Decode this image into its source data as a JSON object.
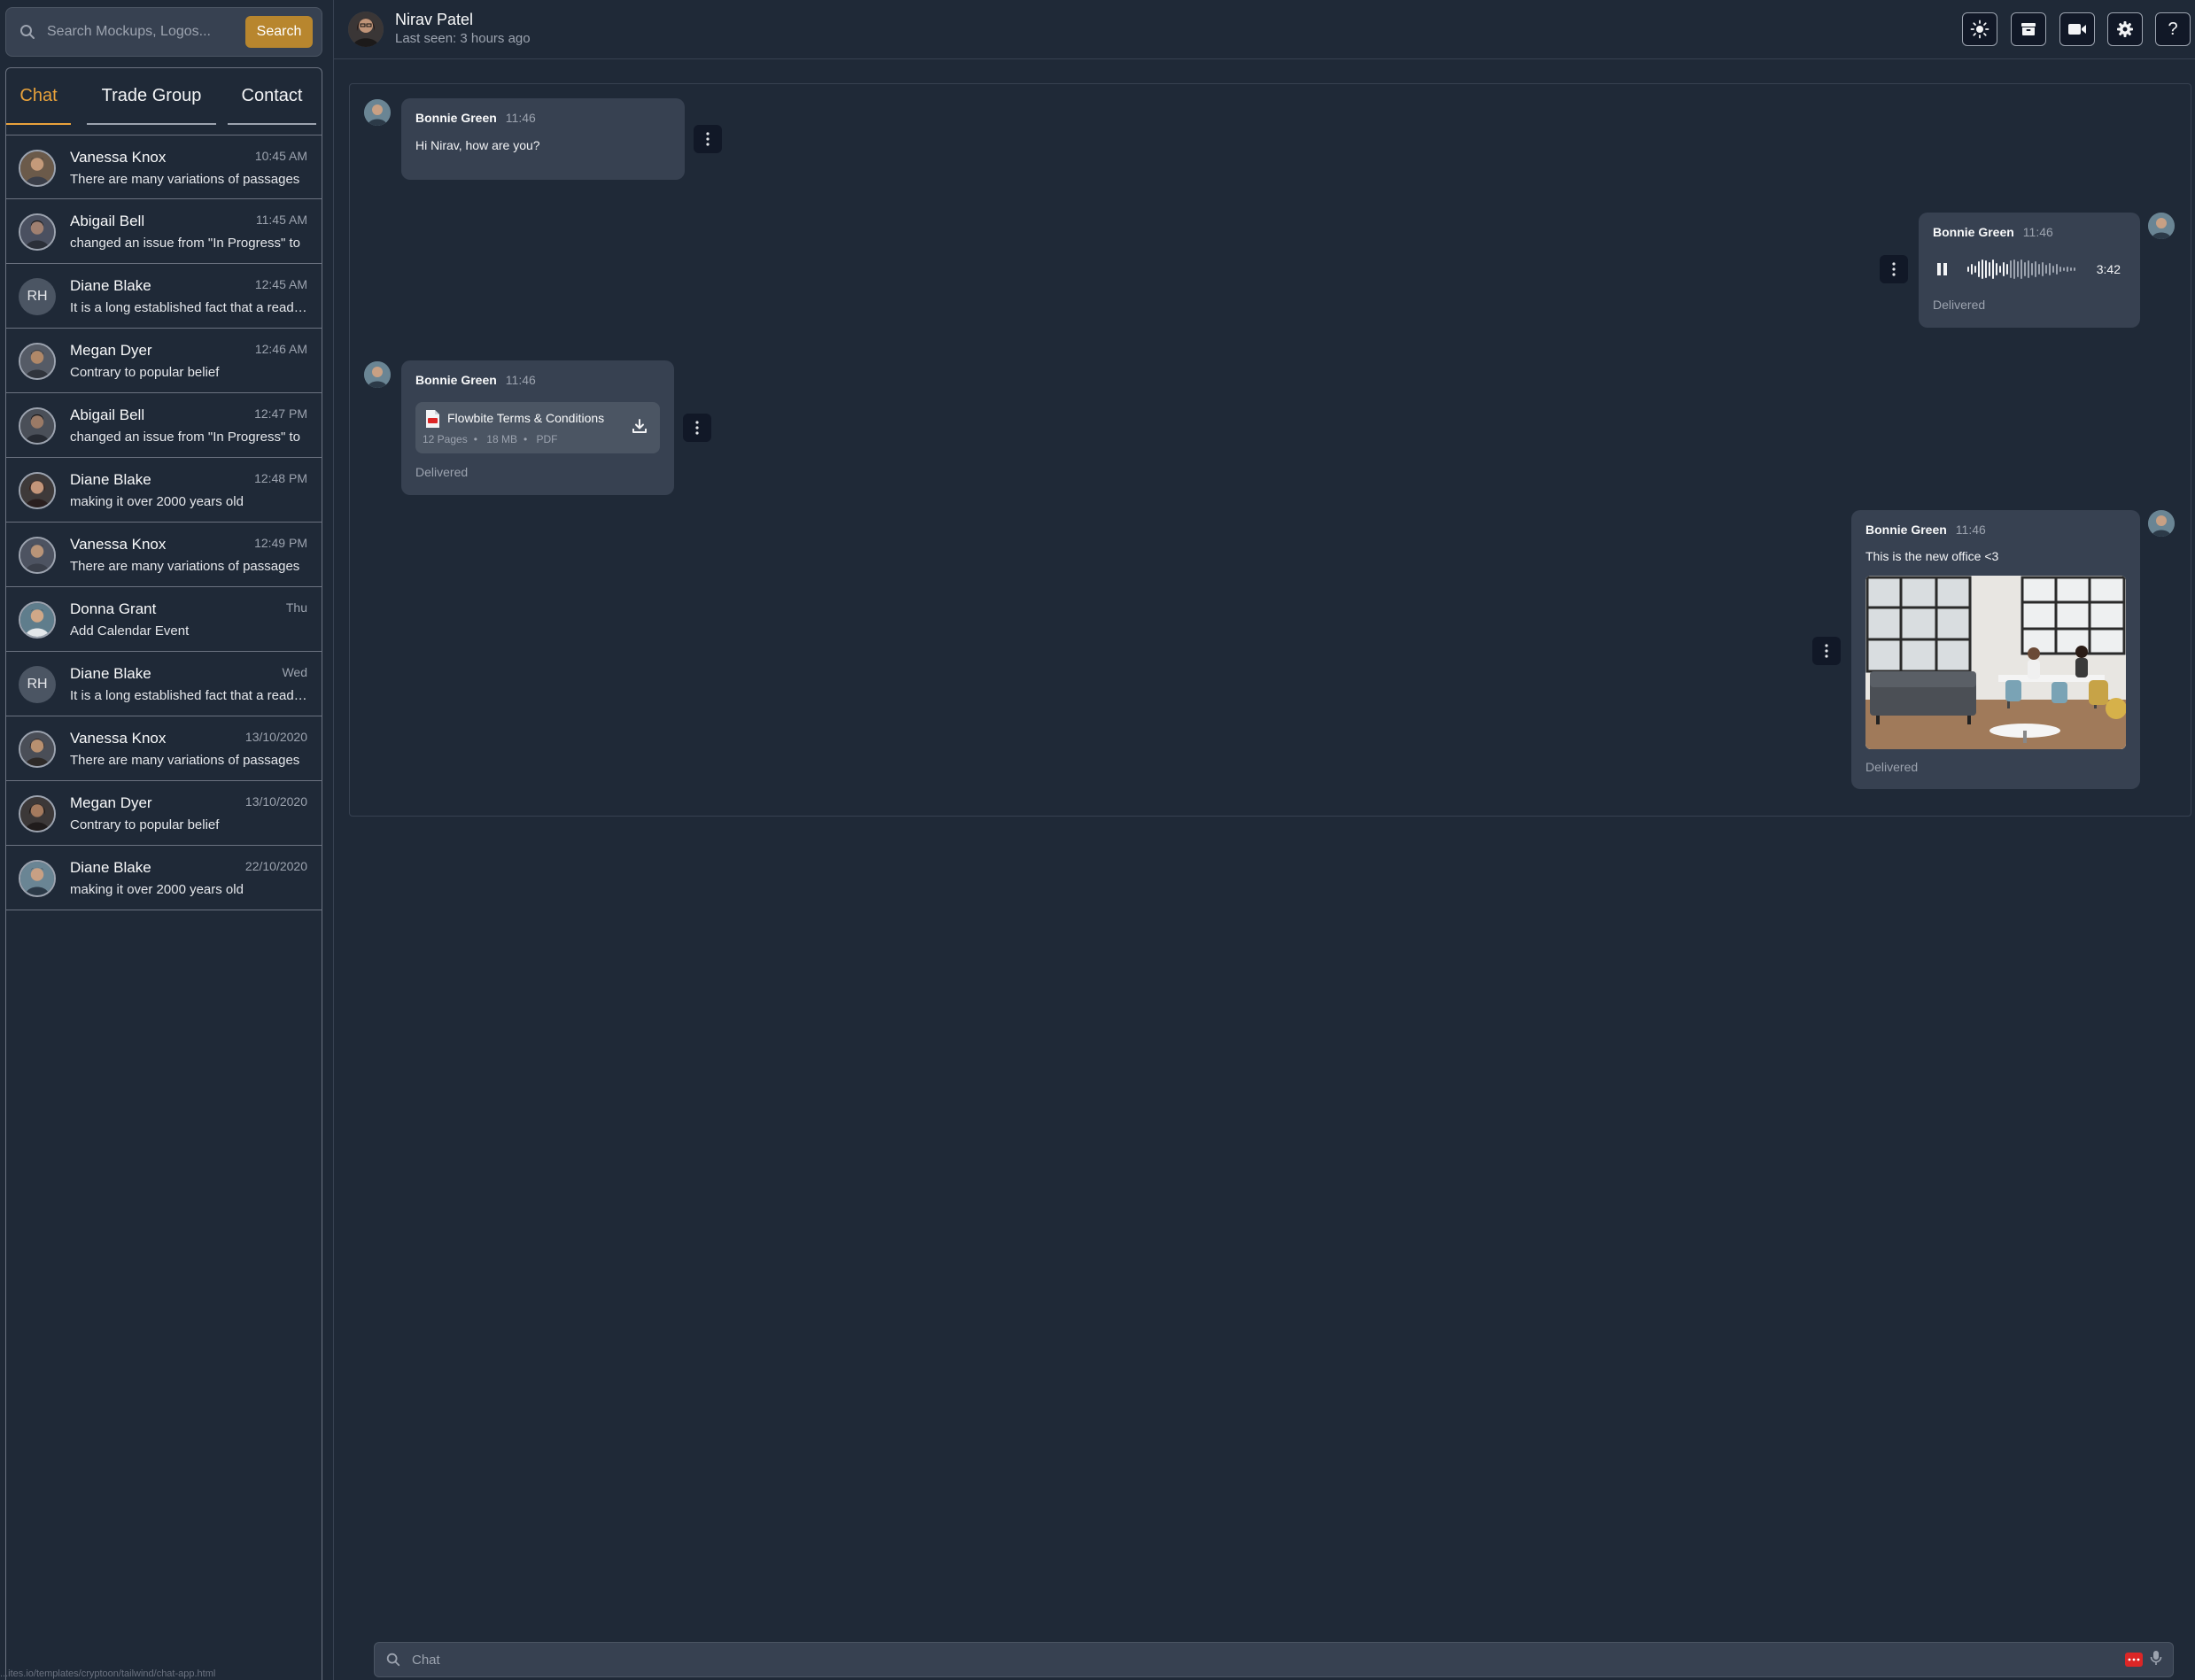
{
  "search": {
    "placeholder": "Search Mockups, Logos...",
    "button_label": "Search"
  },
  "tabs": [
    {
      "label": "Chat",
      "active": true
    },
    {
      "label": "Trade Group",
      "active": false
    },
    {
      "label": "Contact",
      "active": false
    }
  ],
  "contacts": [
    {
      "name": "Vanessa Knox",
      "time": "10:45 AM",
      "message": "There are many variations of passages",
      "avatar": "photo"
    },
    {
      "name": "Abigail Bell",
      "time": "11:45 AM",
      "message": "changed an issue from \"In Progress\" to",
      "avatar": "photo"
    },
    {
      "name": "Diane Blake",
      "time": "12:45 AM",
      "message": "It is a long established fact that a reader will",
      "avatar": "initials",
      "initials": "RH"
    },
    {
      "name": "Megan Dyer",
      "time": "12:46 AM",
      "message": "Contrary to popular belief",
      "avatar": "photo"
    },
    {
      "name": "Abigail Bell",
      "time": "12:47 PM",
      "message": "changed an issue from \"In Progress\" to",
      "avatar": "photo"
    },
    {
      "name": "Diane Blake",
      "time": "12:48 PM",
      "message": "making it over 2000 years old",
      "avatar": "photo"
    },
    {
      "name": "Vanessa Knox",
      "time": "12:49 PM",
      "message": "There are many variations of passages",
      "avatar": "photo"
    },
    {
      "name": "Donna Grant",
      "time": "Thu",
      "message": "Add Calendar Event",
      "avatar": "photo"
    },
    {
      "name": "Diane Blake",
      "time": "Wed",
      "message": "It is a long established fact that a reader will",
      "avatar": "initials",
      "initials": "RH"
    },
    {
      "name": "Vanessa Knox",
      "time": "13/10/2020",
      "message": "There are many variations of passages",
      "avatar": "photo"
    },
    {
      "name": "Megan Dyer",
      "time": "13/10/2020",
      "message": "Contrary to popular belief",
      "avatar": "photo"
    },
    {
      "name": "Diane Blake",
      "time": "22/10/2020",
      "message": "making it over 2000 years old",
      "avatar": "photo"
    }
  ],
  "header": {
    "name": "Nirav Patel",
    "status": "Last seen: 3 hours ago",
    "buttons": [
      "sun-icon",
      "archive-icon",
      "video-icon",
      "gear-icon",
      "help-icon"
    ],
    "help_label": "?"
  },
  "messages": {
    "m1": {
      "sender": "Bonnie Green",
      "time": "11:46",
      "text": "Hi Nirav, how are you?"
    },
    "m2": {
      "sender": "Bonnie Green",
      "time": "11:46",
      "duration": "3:42",
      "status": "Delivered"
    },
    "m3": {
      "sender": "Bonnie Green",
      "time": "11:46",
      "file_name": "Flowbite Terms & Conditions",
      "pages": "12 Pages",
      "size": "18 MB",
      "type": "PDF",
      "status": "Delivered"
    },
    "m4": {
      "sender": "Bonnie Green",
      "time": "11:46",
      "text": "This is the new office <3",
      "status": "Delivered"
    }
  },
  "composer": {
    "placeholder": "Chat"
  },
  "status_bar": {
    "url": "...ites.io/templates/cryptoon/tailwind/chat-app.html"
  },
  "colors": {
    "accent": "#e9a23b",
    "button": "#b8862e",
    "background": "#1f2937",
    "bubble": "#374151"
  }
}
